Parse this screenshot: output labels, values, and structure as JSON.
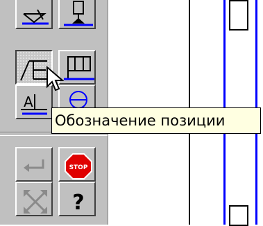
{
  "toolbar": {
    "buttons": [
      {
        "name": "leader-triangle-icon"
      },
      {
        "name": "datum-base-icon"
      },
      {
        "name": "position-callout-icon",
        "state": "pressed"
      },
      {
        "name": "table-block-icon"
      },
      {
        "name": "text-underline-icon"
      },
      {
        "name": "circle-marker-icon"
      },
      {
        "name": "enter-arrow-icon",
        "state": "disabled"
      },
      {
        "name": "stop-icon",
        "label": "STOP"
      },
      {
        "name": "fit-view-icon",
        "state": "disabled"
      },
      {
        "name": "help-icon",
        "label": "?"
      }
    ]
  },
  "tooltip": {
    "text": "Обозначение позиции"
  },
  "colors": {
    "panel": "#c0c0c0",
    "accent_blue": "#0000ff",
    "stop_red": "#e00000",
    "tooltip_bg": "#ffffe1"
  }
}
